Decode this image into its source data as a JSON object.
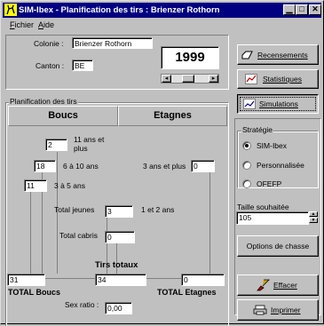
{
  "window": {
    "title": "SIM-Ibex - Planification des tirs : Brienzer Rothorn",
    "minimize_glyph": "▁",
    "maximize_glyph": "□",
    "close_glyph": "✕"
  },
  "menu": {
    "file_first": "F",
    "file_rest": "ichier",
    "help_first": "A",
    "help_rest": "ide"
  },
  "info": {
    "colonie_label": "Colonie :",
    "colonie_value": "Brienzer Rothorn",
    "canton_label": "Canton :",
    "canton_value": "BE",
    "year": "1999",
    "scroll_left": "◂",
    "scroll_right": "▸"
  },
  "actions": {
    "recensements": "Recensements",
    "statistiques": "Statistiques",
    "simulations": "Simulations"
  },
  "planning": {
    "group_title": "Planification des tirs",
    "boucs_header": "Boucs",
    "etagnes_header": "Etagnes",
    "age_11_label": "11 ans et plus",
    "age_11_line1": "11 ans et",
    "age_11_line2": "plus",
    "age_11_value": "2",
    "age_6_10_label": "6 à 10 ans",
    "age_6_10_value": "18",
    "age_3_5_label": "3 à 5 ans",
    "age_3_5_value": "11",
    "etagnes_3_label": "3 ans et plus",
    "etagnes_3_value": "0",
    "total_jeunes_label": "Total jeunes",
    "total_jeunes_value": "3",
    "age_1_2_label": "1 et 2 ans",
    "total_cabris_label": "Total cabris",
    "total_cabris_value": "0",
    "tirs_totaux_label": "Tirs totaux",
    "total_boucs_value": "31",
    "tirs_totaux_value": "34",
    "total_etagnes_value": "0",
    "total_boucs_label": "TOTAL Boucs",
    "total_etagnes_label": "TOTAL Etagnes",
    "sex_ratio_label": "Sex ratio :",
    "sex_ratio_value": "0,00"
  },
  "strategie": {
    "group_title": "Stratégie",
    "options": [
      {
        "label": "SIM-Ibex",
        "selected": true
      },
      {
        "label": "Personnalisée",
        "selected": false
      },
      {
        "label": "OFEFP",
        "selected": false
      }
    ],
    "taille_label": "Taille souhaitée",
    "taille_value": "105",
    "options_chasse": "Options de chasse"
  },
  "bottom_buttons": {
    "effacer": "Effacer",
    "imprimer": "Imprimer"
  },
  "colors": {
    "title_bar": "#000080",
    "face": "#c0c0c0"
  }
}
